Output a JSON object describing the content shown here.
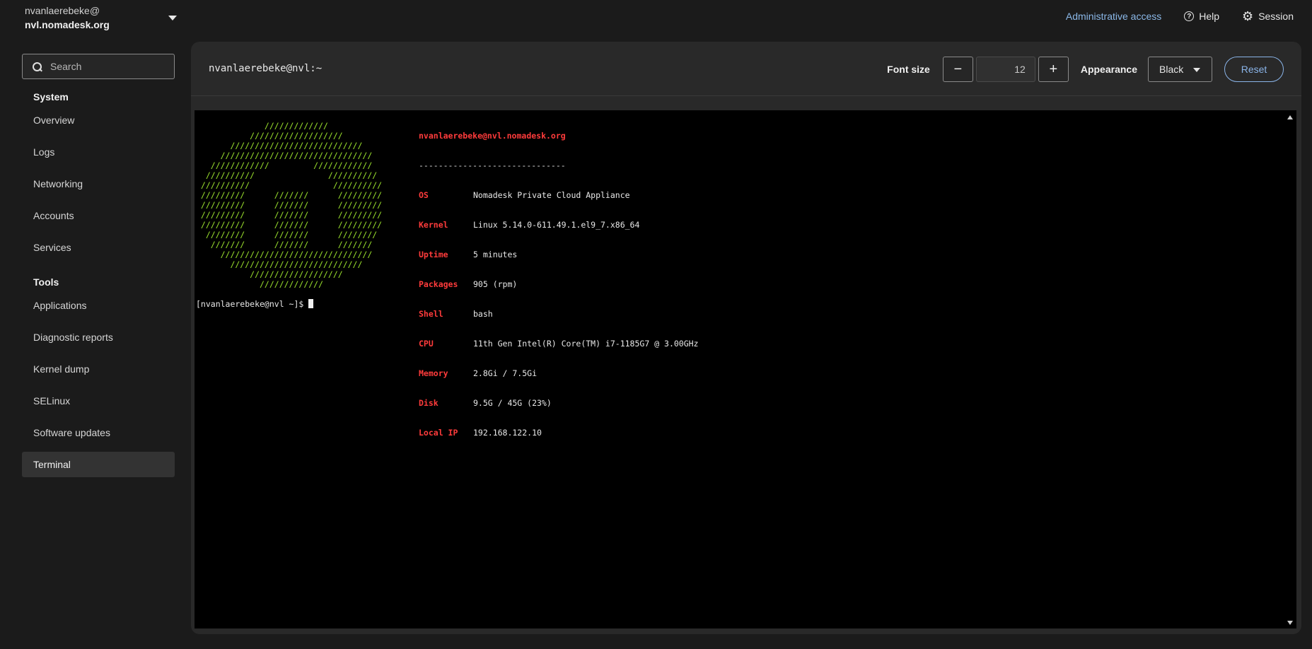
{
  "header": {
    "user": "nvanlaerebeke@",
    "host": "nvl.nomadesk.org",
    "admin_access": "Administrative access",
    "help": "Help",
    "session": "Session"
  },
  "sidebar": {
    "search_placeholder": "Search",
    "sections": [
      {
        "title": "System",
        "items": [
          "Overview",
          "Logs",
          "Networking",
          "Accounts",
          "Services"
        ]
      },
      {
        "title": "Tools",
        "items": [
          "Applications",
          "Diagnostic reports",
          "Kernel dump",
          "SELinux",
          "Software updates",
          "Terminal"
        ]
      }
    ],
    "active_item": "Terminal"
  },
  "toolbar": {
    "title": "nvanlaerebeke@nvl:~",
    "font_size_label": "Font size",
    "decrease": "−",
    "font_size_value": "12",
    "increase": "+",
    "appearance_label": "Appearance",
    "appearance_value": "Black",
    "reset": "Reset"
  },
  "terminal": {
    "logo_color": "#9be22d",
    "key_color": "#ff3b3b",
    "header": "nvanlaerebeke@nvl.nomadesk.org",
    "separator": "------------------------------",
    "info": [
      {
        "key": "OS",
        "value": "Nomadesk Private Cloud Appliance"
      },
      {
        "key": "Kernel",
        "value": "Linux 5.14.0-611.49.1.el9_7.x86_64"
      },
      {
        "key": "Uptime",
        "value": "5 minutes"
      },
      {
        "key": "Packages",
        "value": "905 (rpm)"
      },
      {
        "key": "Shell",
        "value": "bash"
      },
      {
        "key": "CPU",
        "value": "11th Gen Intel(R) Core(TM) i7-1185G7 @ 3.00GHz"
      },
      {
        "key": "Memory",
        "value": "2.8Gi / 7.5Gi"
      },
      {
        "key": "Disk",
        "value": "9.5G / 45G (23%)"
      },
      {
        "key": "Local IP",
        "value": "192.168.122.10"
      }
    ],
    "prompt": "[nvanlaerebeke@nvl ~]$ ",
    "logo": "              /////////////\n           ///////////////////\n       ///////////////////////////\n     ///////////////////////////////\n   ////////////         ////////////\n  //////////               //////////\n //////////                 //////////\n /////////      ///////      /////////\n /////////      ///////      /////////\n /////////      ///////      /////////\n /////////      ///////      /////////\n  ////////      ///////      ////////\n   ///////      ///////      ///////\n     ///////////////////////////////\n       ///////////////////////////\n           ///////////////////\n             /////////////"
  }
}
